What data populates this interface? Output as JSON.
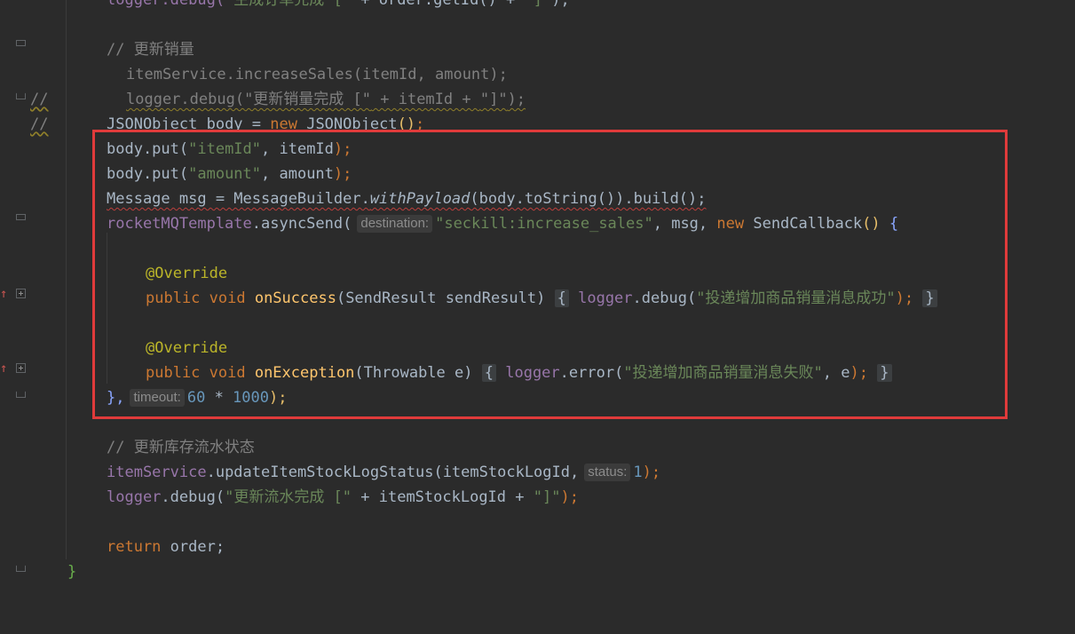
{
  "lines": {
    "l0": {
      "pre": "logger.debug(",
      "str": "\"生成订单完成 [\"",
      "mid": " + order.getId() + ",
      "str2": "\"]\"",
      "post": ");"
    },
    "l2": {
      "comment": "// 更新销量"
    },
    "l3": {
      "mark": "//",
      "code": "itemService.increaseSales(itemId, amount);"
    },
    "l4": {
      "mark": "//",
      "pre": "logger.debug(",
      "str": "\"更新销量完成 [\"",
      "mid": " + itemId + ",
      "str2": "\"]\"",
      "post": ");"
    },
    "l5": {
      "type": "JSONObject",
      "var": " body = ",
      "kw": "new",
      "cls": " JSONObject",
      "paren": "()",
      "end": ";"
    },
    "l6": {
      "pre": "body.put(",
      "str": "\"itemId\"",
      "mid": ", itemId",
      "post": ");"
    },
    "l7": {
      "pre": "body.put(",
      "str": "\"amount\"",
      "mid": ", amount",
      "post": ");"
    },
    "l8": {
      "pre": "Message msg = MessageBuilder.",
      "method": "withPayload",
      "post": "(body.toString()).build();"
    },
    "l9": {
      "field": "rocketMQTemplate",
      "call": ".asyncSend(",
      "hint": "destination:",
      "str": "\"seckill:increase_sales\"",
      "mid": ", msg, ",
      "kw": "new",
      "cls": " SendCallback",
      "paren": "()",
      "brace": " {"
    },
    "l11": {
      "ann": "@Override"
    },
    "l12": {
      "kw": "public void ",
      "fn": "onSuccess",
      "params": "(SendResult sendResult)",
      "open": "{",
      "field": "logger",
      "call": ".debug(",
      "str": "\"投递增加商品销量消息成功\"",
      "post": ");",
      "close": "}"
    },
    "l14": {
      "ann": "@Override"
    },
    "l15": {
      "kw": "public void ",
      "fn": "onException",
      "params": "(Throwable e)",
      "open": "{",
      "field": "logger",
      "call": ".error(",
      "str": "\"投递增加商品销量消息失败\"",
      "mid": ", e",
      "post": ");",
      "close": "}"
    },
    "l16": {
      "pre": "},",
      "hint": "timeout:",
      "num1": "60",
      "op": " * ",
      "num2": "1000",
      "post": ");"
    },
    "l18": {
      "comment": "// 更新库存流水状态"
    },
    "l19": {
      "field": "itemService",
      "call": ".updateItemStockLogStatus(itemStockLogId,",
      "hint": "status:",
      "num": "1",
      "post": ");"
    },
    "l20": {
      "field": "logger",
      "call": ".debug(",
      "str": "\"更新流水完成 [\"",
      "mid": " + itemStockLogId + ",
      "str2": "\"]\"",
      "post": ");"
    },
    "l22": {
      "kw": "return",
      "post": " order;"
    },
    "l23": {
      "brace": "}"
    }
  },
  "colors": {
    "background": "#2b2b2b",
    "keyword": "#cc7832",
    "string": "#6a8759",
    "number": "#6897bb",
    "field": "#9876aa",
    "method": "#ffc66d",
    "annotation": "#bbb529",
    "comment": "#808080",
    "highlight_box": "#e03b3b"
  }
}
